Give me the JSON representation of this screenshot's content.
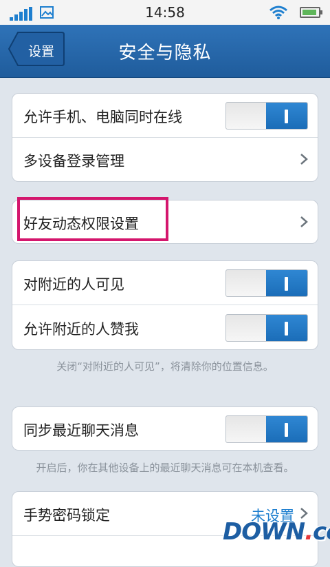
{
  "status_bar": {
    "time": "14:58"
  },
  "nav": {
    "back_label": "设置",
    "title": "安全与隐私"
  },
  "groups": [
    {
      "rows": [
        {
          "label": "允许手机、电脑同时在线",
          "toggle_on": true
        },
        {
          "label": "多设备登录管理"
        }
      ]
    },
    {
      "rows": [
        {
          "label": "好友动态权限设置"
        }
      ]
    },
    {
      "rows": [
        {
          "label": "对附近的人可见",
          "toggle_on": true
        },
        {
          "label": "允许附近的人赞我",
          "toggle_on": true
        }
      ],
      "hint": "关闭“对附近的人可见”，将清除你的位置信息。"
    },
    {
      "rows": [
        {
          "label": "同步最近聊天消息",
          "toggle_on": true
        }
      ],
      "hint": "开启后，你在其他设备上的最近聊天消息可在本机查看。"
    },
    {
      "rows": [
        {
          "label": "手势密码锁定",
          "value": "未设置"
        }
      ]
    }
  ],
  "watermark": {
    "text": "DOWN",
    "suffix": "cc"
  },
  "colors": {
    "accent": "#1e7fcf",
    "nav_bg": "#2a6bb0",
    "highlight": "#d4166d"
  }
}
